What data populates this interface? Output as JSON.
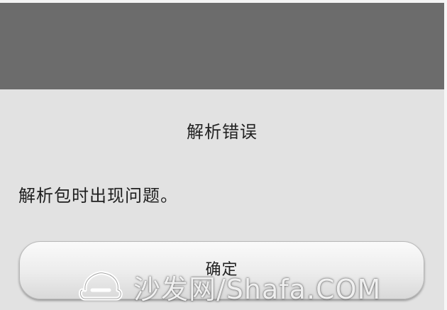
{
  "dialog": {
    "title": "解析错误",
    "message": "解析包时出现问题。",
    "ok_label": "确定"
  },
  "watermark": {
    "text": "沙发网/Shafa.COM"
  },
  "colors": {
    "overlay": "#6c6c6c",
    "dialog_background": "#e2e2e2",
    "button_border": "#b9b9b9"
  }
}
